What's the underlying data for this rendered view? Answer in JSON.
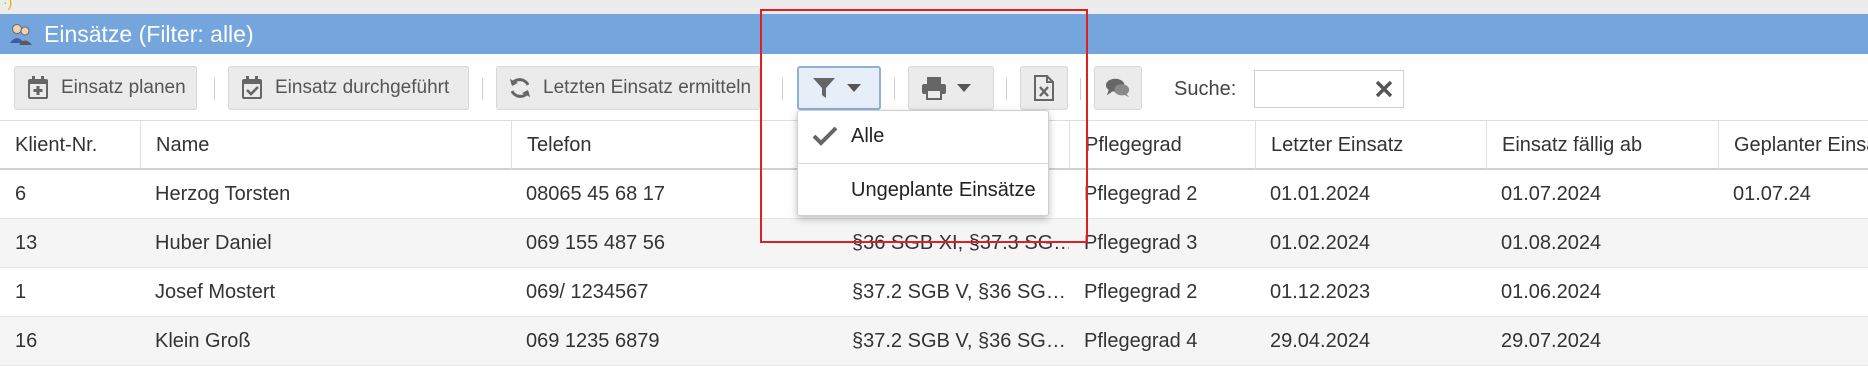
{
  "window": {
    "title": "Einsätze (Filter: alle)"
  },
  "toolbar": {
    "plan_label": "Einsatz planen",
    "done_label": "Einsatz durchgeführt",
    "last_label": "Letzten Einsatz ermitteln",
    "search_label": "Suche:",
    "search_value": ""
  },
  "filter_menu": {
    "options": [
      {
        "label": "Alle",
        "selected": true
      },
      {
        "label": "Ungeplante Einsätze",
        "selected": false
      }
    ]
  },
  "table": {
    "columns": [
      "Klient-Nr.",
      "Name",
      "Telefon",
      "",
      "Pflegegrad",
      "Letzter Einsatz",
      "Einsatz fällig ab",
      "Geplanter Einsa"
    ],
    "rows": [
      [
        "6",
        "Herzog Torsten",
        "08065 45 68 17",
        "",
        "Pflegegrad 2",
        "01.01.2024",
        "01.07.2024",
        "01.07.24"
      ],
      [
        "13",
        "Huber Daniel",
        "069 155 487 56",
        "§36 SGB XI, §37.3 SG…",
        "Pflegegrad 3",
        "01.02.2024",
        "01.08.2024",
        ""
      ],
      [
        "1",
        "Josef Mostert",
        "069/ 1234567",
        "§37.2 SGB V, §36 SG…",
        "Pflegegrad 2",
        "01.12.2023",
        "01.06.2024",
        ""
      ],
      [
        "16",
        "Klein Groß",
        "069 1235 6879",
        "§37.2 SGB V, §36 SG…",
        "Pflegegrad 4",
        "29.04.2024",
        "29.07.2024",
        ""
      ]
    ]
  },
  "colors": {
    "titlebar": "#74a5dc",
    "highlight": "#e02020"
  }
}
